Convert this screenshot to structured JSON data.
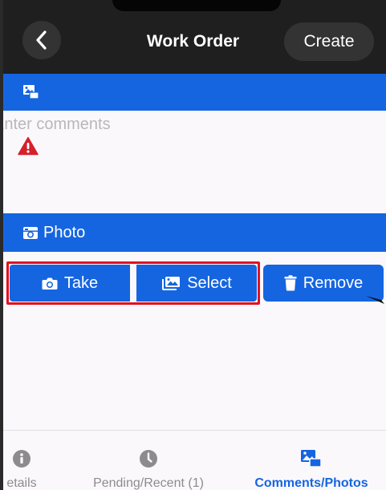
{
  "header": {
    "title": "Work Order",
    "back_icon": "chevron-left-icon",
    "create_label": "Create"
  },
  "comments": {
    "section_icon": "photos-icon",
    "placeholder": "Enter comments",
    "value": "",
    "validation_icon": "warning-icon"
  },
  "photo": {
    "section_icon": "camera-retro-icon",
    "section_label": "Photo",
    "take_label": "Take",
    "select_label": "Select",
    "remove_label": "Remove"
  },
  "tabs": [
    {
      "label": "etails",
      "icon": "info-icon",
      "active": false
    },
    {
      "label": "Pending/Recent (1)",
      "icon": "clock-icon",
      "active": false
    },
    {
      "label": "Comments/Photos",
      "icon": "photos-icon",
      "active": true
    }
  ],
  "colors": {
    "primary": "#1565e0",
    "header_bg": "#1f1f1f",
    "highlight": "#e0121f",
    "warning": "#d6202a",
    "inactive_tab": "#8c8c8c"
  }
}
